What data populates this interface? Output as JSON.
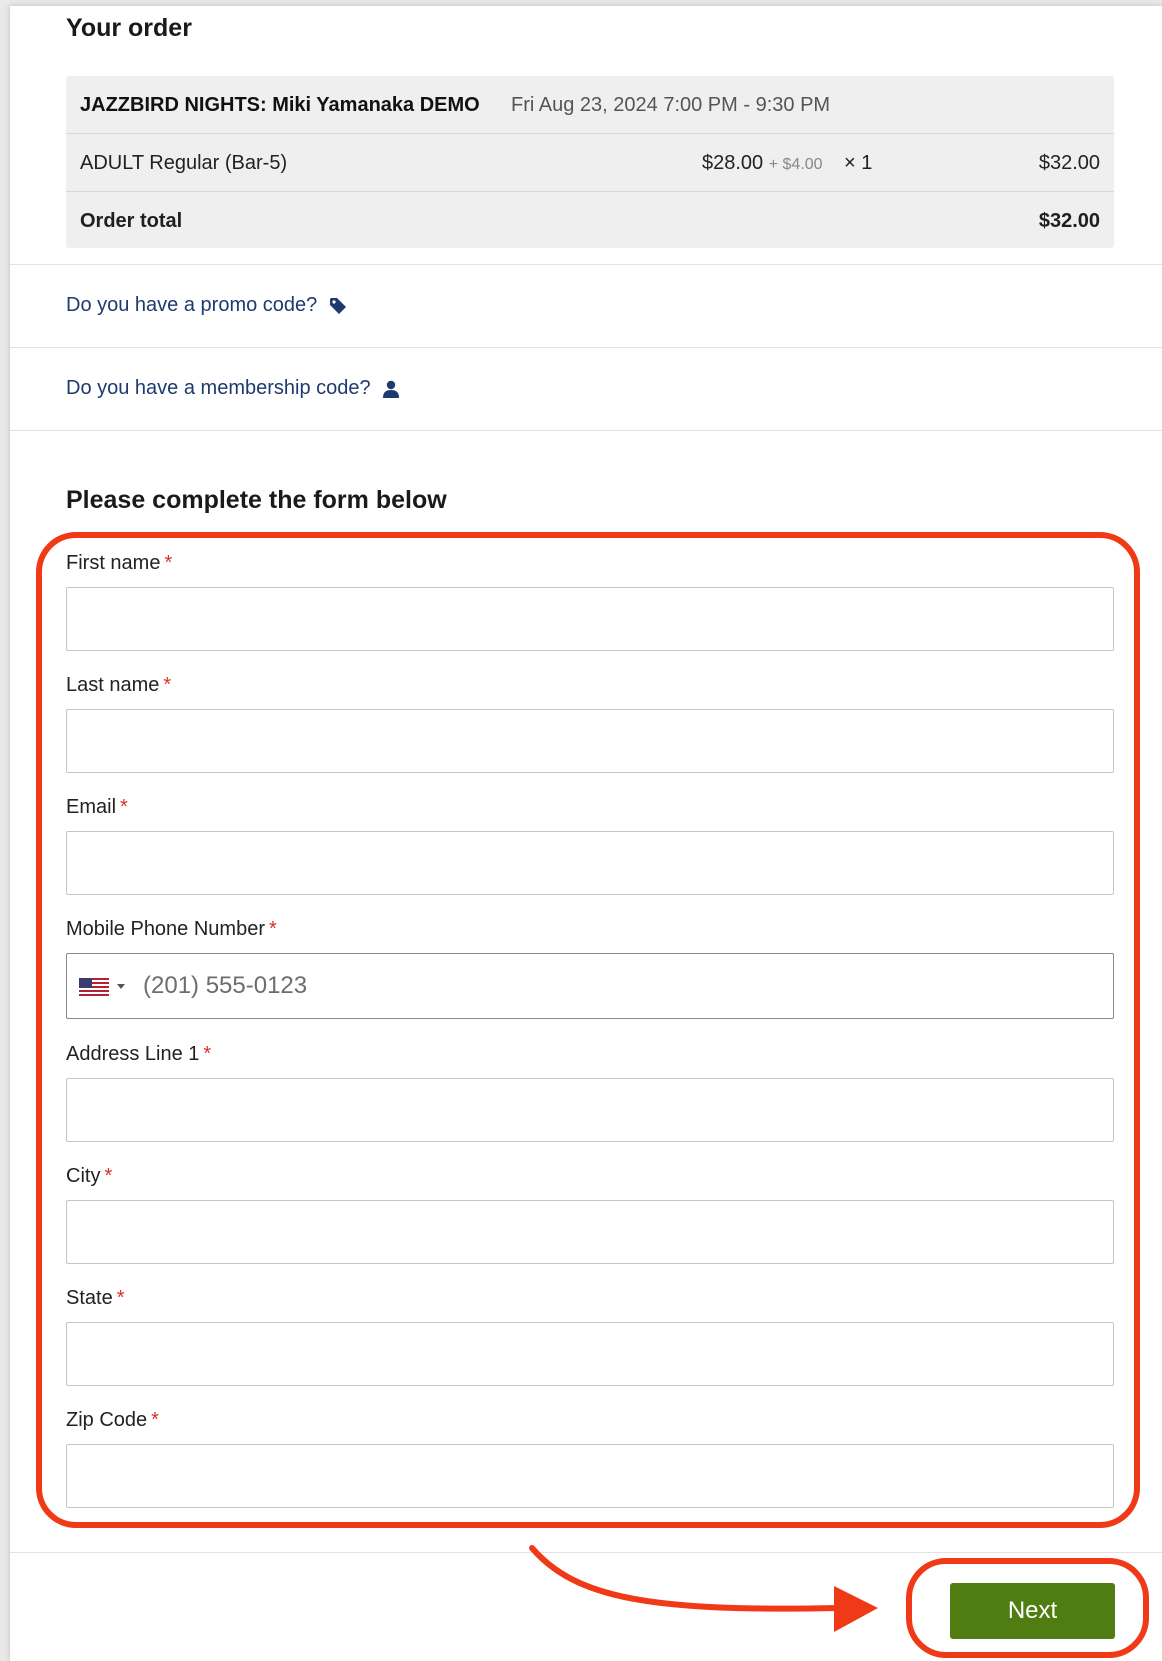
{
  "order": {
    "title": "Your order",
    "event_name": "JAZZBIRD NIGHTS: Miki Yamanaka DEMO",
    "event_date": "Fri Aug 23, 2024 7:00 PM - 9:30 PM",
    "item": {
      "name": "ADULT Regular (Bar-5)",
      "price": "$28.00",
      "fee": "+ $4.00",
      "quantity": "× 1",
      "total": "$32.00"
    },
    "total_label": "Order total",
    "total_value": "$32.00"
  },
  "promo": {
    "label": "Do you have a promo code?",
    "icon": "tag-icon"
  },
  "membership": {
    "label": "Do you have a membership code?",
    "icon": "user-icon"
  },
  "form": {
    "title": "Please complete the form below",
    "required_marker": "*",
    "fields": [
      {
        "label": "First name",
        "value": ""
      },
      {
        "label": "Last name",
        "value": ""
      },
      {
        "label": "Email",
        "value": ""
      },
      {
        "label": "Mobile Phone Number",
        "placeholder": "(201) 555-0123",
        "country_flag": "us-flag-icon"
      },
      {
        "label": "Address Line 1",
        "value": ""
      },
      {
        "label": "City",
        "value": ""
      },
      {
        "label": "State",
        "value": ""
      },
      {
        "label": "Zip Code",
        "value": ""
      }
    ]
  },
  "next_button": {
    "label": "Next"
  },
  "colors": {
    "accent_button": "#4f7d12",
    "annotation": "#f03a17",
    "link": "#1e3a6e",
    "required": "#d93025"
  }
}
